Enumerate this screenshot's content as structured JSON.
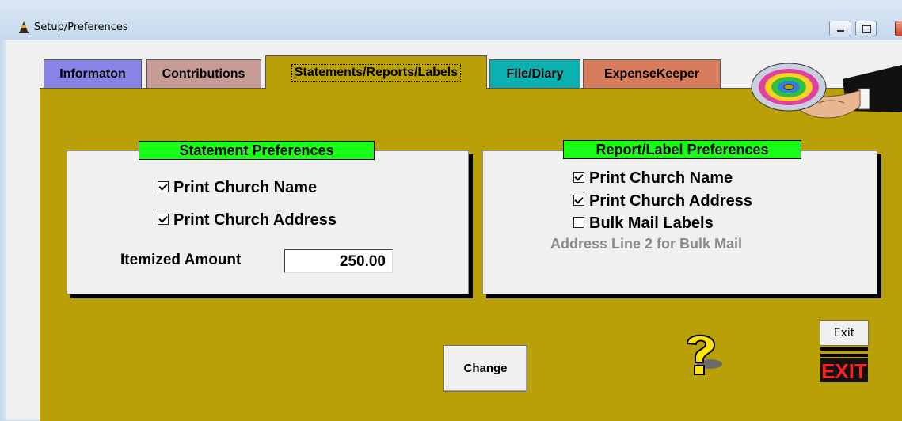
{
  "window": {
    "title": "Setup/Preferences"
  },
  "tabs": [
    {
      "label": "Informaton",
      "color": "#8a83e6"
    },
    {
      "label": "Contributions",
      "color": "#c79c97"
    },
    {
      "label": "Statements/Reports/Labels",
      "color": "#b8a006",
      "active": true
    },
    {
      "label": "File/Diary",
      "color": "#0db0b0"
    },
    {
      "label": "ExpenseKeeper",
      "color": "#d77c5c"
    }
  ],
  "statement_prefs": {
    "title": "Statement Preferences",
    "print_church_name": {
      "label": "Print Church Name",
      "checked": true
    },
    "print_church_address": {
      "label": "Print Church Address",
      "checked": true
    },
    "itemized_label": "Itemized Amount",
    "itemized_value": "250.00"
  },
  "report_prefs": {
    "title": "Report/Label Preferences",
    "print_church_name": {
      "label": "Print Church Name",
      "checked": true
    },
    "print_church_address": {
      "label": "Print Church Address",
      "checked": true
    },
    "bulk_mail_labels": {
      "label": "Bulk Mail Labels",
      "checked": false
    },
    "address_line2": "Address Line 2 for Bulk Mail"
  },
  "buttons": {
    "change": "Change",
    "exit": "Exit"
  },
  "icons": {
    "app": "app-icon",
    "help": "question-mark-icon",
    "exit_sign": "exit-sign-icon",
    "cd_hand": "hand-holding-cd-icon"
  },
  "colors": {
    "page_bg": "#b8a006",
    "panel_title_bg": "#17ff17"
  }
}
